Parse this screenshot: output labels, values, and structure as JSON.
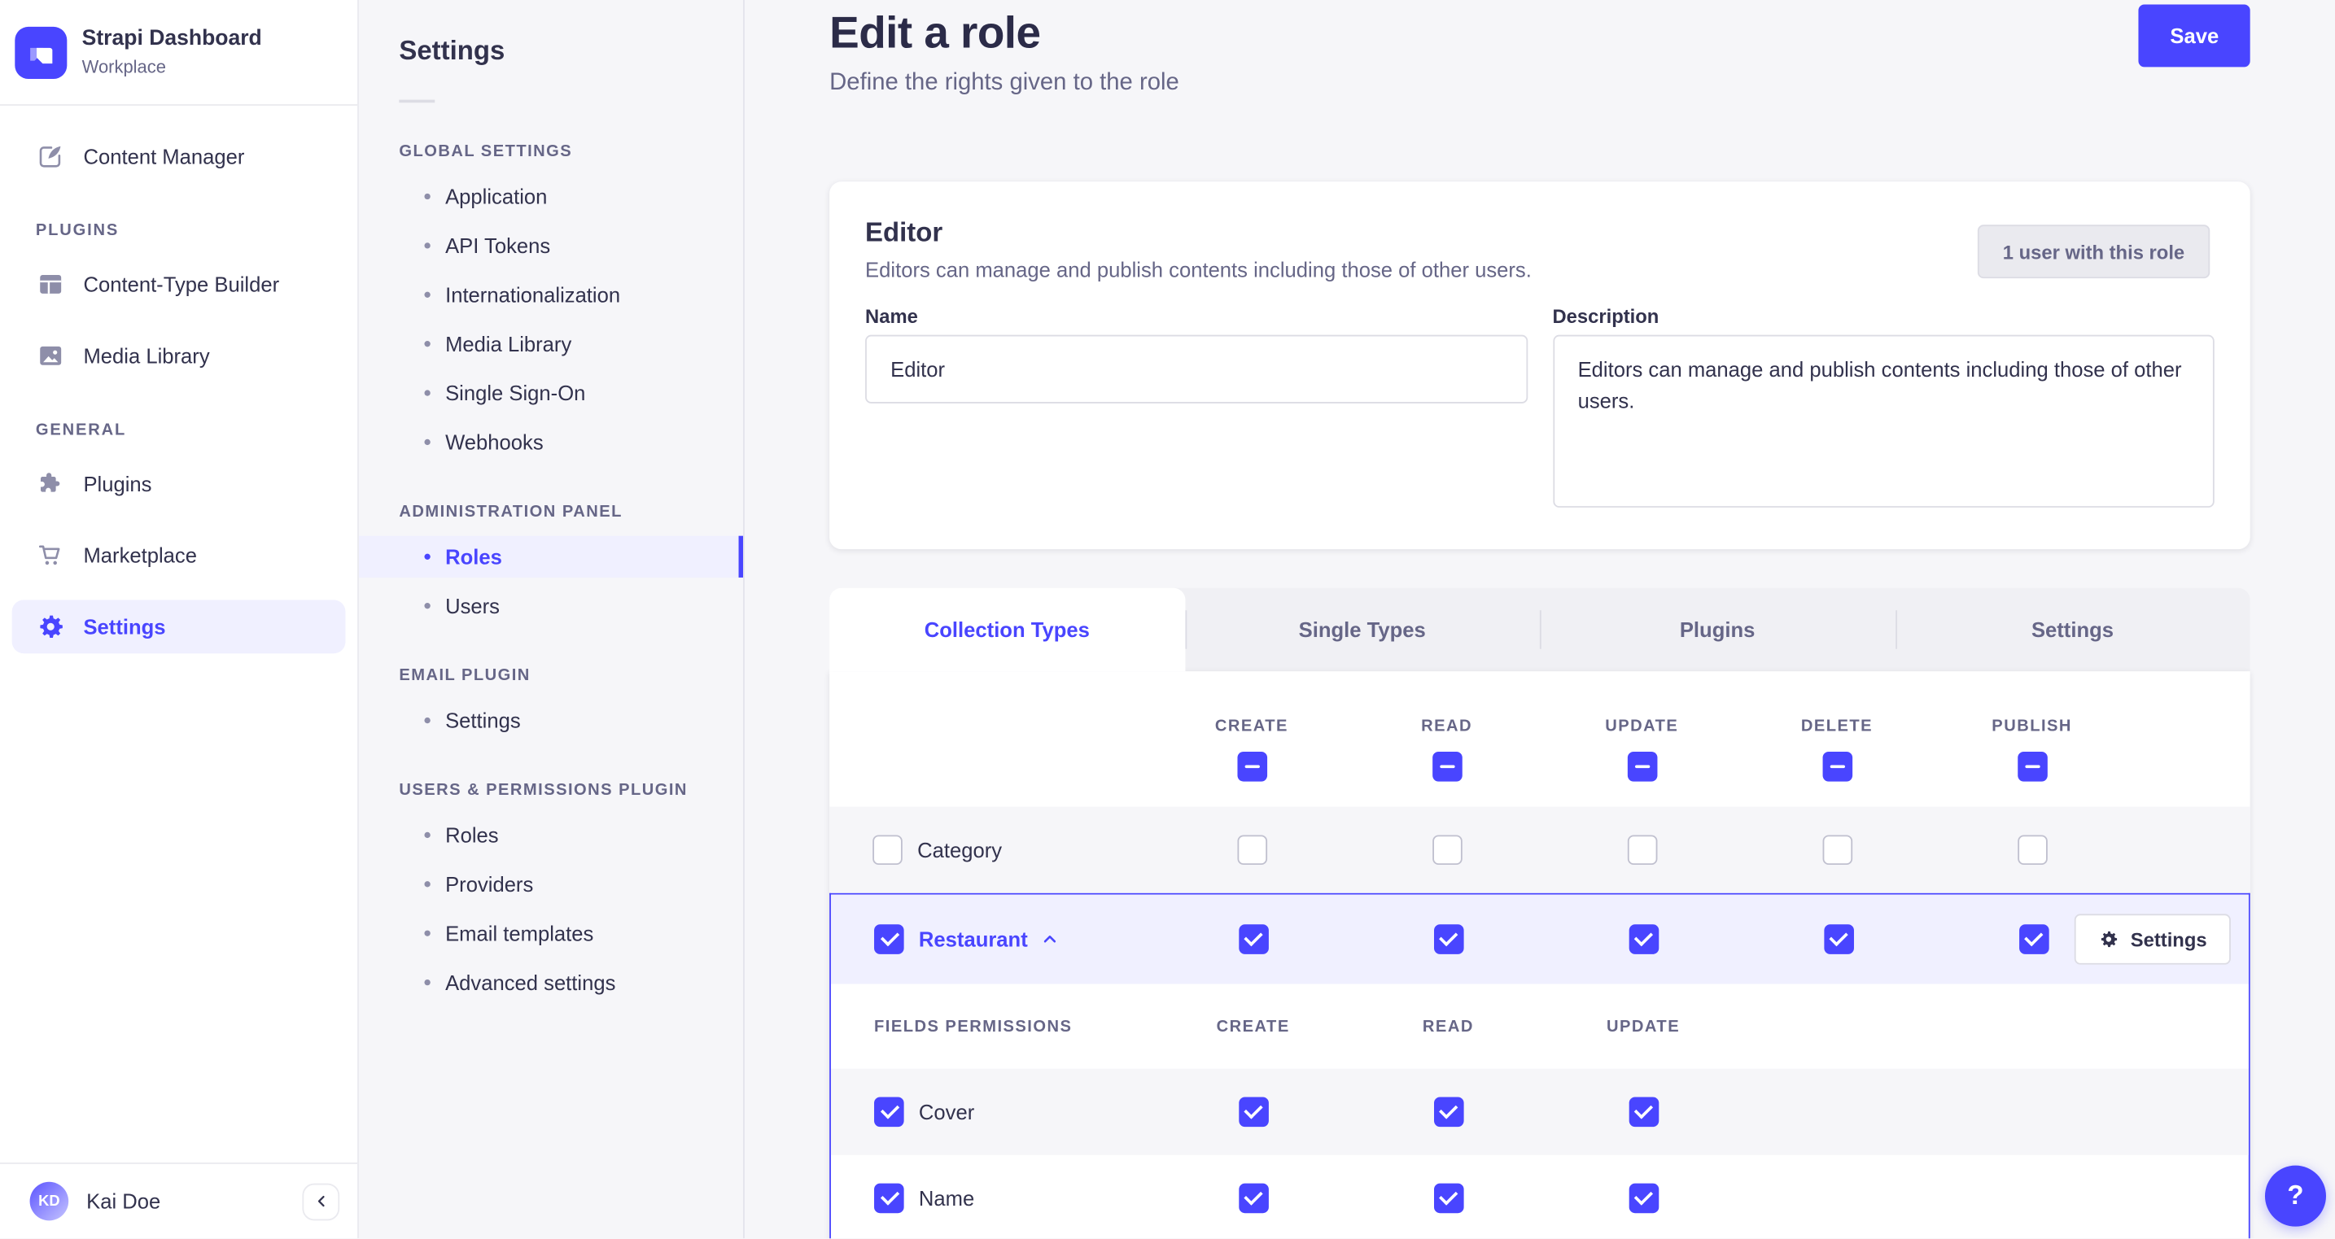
{
  "app": {
    "title": "Strapi Dashboard",
    "subtitle": "Workplace",
    "logo_icon": "strapi-logo-icon"
  },
  "sidebar": {
    "content_manager": {
      "label": "Content Manager",
      "icon": "pencil-square-icon"
    },
    "sections": [
      {
        "label": "PLUGINS",
        "items": [
          {
            "label": "Content-Type Builder",
            "icon": "layout-icon"
          },
          {
            "label": "Media Library",
            "icon": "picture-icon"
          }
        ]
      },
      {
        "label": "GENERAL",
        "items": [
          {
            "label": "Plugins",
            "icon": "puzzle-icon"
          },
          {
            "label": "Marketplace",
            "icon": "cart-icon"
          },
          {
            "label": "Settings",
            "icon": "gear-icon",
            "active": true
          }
        ]
      }
    ],
    "footer": {
      "initials": "KD",
      "name": "Kai Doe",
      "collapse_icon": "chevron-left-icon"
    }
  },
  "subnav": {
    "title": "Settings",
    "sections": [
      {
        "label": "GLOBAL SETTINGS",
        "items": [
          {
            "label": "Application"
          },
          {
            "label": "API Tokens"
          },
          {
            "label": "Internationalization"
          },
          {
            "label": "Media Library"
          },
          {
            "label": "Single Sign-On"
          },
          {
            "label": "Webhooks"
          }
        ]
      },
      {
        "label": "ADMINISTRATION PANEL",
        "items": [
          {
            "label": "Roles",
            "active": true
          },
          {
            "label": "Users"
          }
        ]
      },
      {
        "label": "EMAIL PLUGIN",
        "items": [
          {
            "label": "Settings"
          }
        ]
      },
      {
        "label": "USERS & PERMISSIONS PLUGIN",
        "items": [
          {
            "label": "Roles"
          },
          {
            "label": "Providers"
          },
          {
            "label": "Email templates"
          },
          {
            "label": "Advanced settings"
          }
        ]
      }
    ]
  },
  "page": {
    "title": "Edit a role",
    "subtitle": "Define the rights given to the role",
    "save_label": "Save"
  },
  "role_card": {
    "title": "Editor",
    "subtitle": "Editors can manage and publish contents including those of other users.",
    "users_badge": "1 user with this role",
    "name_label": "Name",
    "name_value": "Editor",
    "description_label": "Description",
    "description_value": "Editors can manage and publish contents including those of other users."
  },
  "tabs": [
    {
      "label": "Collection Types",
      "active": true
    },
    {
      "label": "Single Types",
      "active": false
    },
    {
      "label": "Plugins",
      "active": false
    },
    {
      "label": "Settings",
      "active": false
    }
  ],
  "permissions": {
    "columns": [
      "CREATE",
      "READ",
      "UPDATE",
      "DELETE",
      "PUBLISH"
    ],
    "select_all_state": "indeterminate",
    "rows": [
      {
        "label": "Category",
        "row_checked": false,
        "expanded": false,
        "cells": [
          false,
          false,
          false,
          false,
          false
        ]
      },
      {
        "label": "Restaurant",
        "row_checked": true,
        "expanded": true,
        "cells": [
          true,
          true,
          true,
          true,
          true
        ],
        "settings_button": "Settings",
        "expand_icon": "chevron-up-icon"
      }
    ],
    "fields": {
      "title": "FIELDS PERMISSIONS",
      "columns": [
        "CREATE",
        "READ",
        "UPDATE"
      ],
      "rows": [
        {
          "label": "Cover",
          "row_checked": true,
          "cells": [
            true,
            true,
            true
          ]
        },
        {
          "label": "Name",
          "row_checked": true,
          "cells": [
            true,
            true,
            true
          ]
        }
      ]
    }
  },
  "help": {
    "label": "?",
    "icon": "question-mark-icon"
  },
  "colors": {
    "primary": "#4945ff",
    "primary_light": "#f0f0ff",
    "text_dark": "#32324d",
    "text_muted": "#666687",
    "page_bg": "#f6f6f9"
  }
}
